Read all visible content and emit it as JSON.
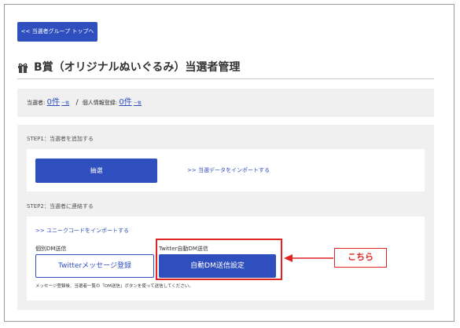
{
  "back_button": {
    "label": "<< 当選者グループ トップへ"
  },
  "page": {
    "title": "B賞（オリジナルぬいぐるみ）当選者管理",
    "icon": "gift-icon"
  },
  "summary": {
    "winners_label": "当選者:",
    "winners_count": "0件",
    "winners_list_link": "一覧",
    "separator": "/",
    "personal_info_label": "個人情報登録:",
    "personal_info_count": "0件",
    "personal_info_list_link": "一覧"
  },
  "step1": {
    "label": "STEP1：当選者を追加する",
    "lottery_button": "抽選",
    "import_link": ">> 当選データをインポートする"
  },
  "step2": {
    "label": "STEP2：当選者に連絡する",
    "unique_code_link": ">> ユニークコードをインポートする",
    "individual_dm_label": "個別DM送信",
    "twitter_message_button": "Twitterメッセージ登録",
    "auto_dm_label": "Twitter自動DM送信",
    "auto_dm_button": "自動DM送信設定",
    "note": "メッセージ登録後、当選者一覧の「DM送信」ボタンを使って送信してください。"
  },
  "annotation": {
    "callout_text": "こちら",
    "color": "#e02424"
  },
  "colors": {
    "accent": "#2f4fbf",
    "panel_bg": "#f0f0f0"
  }
}
